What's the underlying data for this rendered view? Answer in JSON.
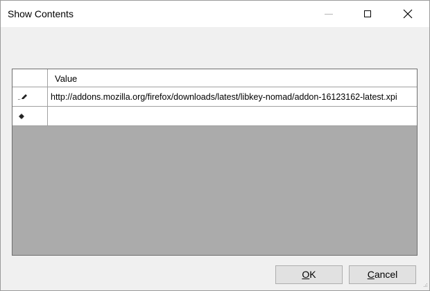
{
  "window": {
    "title": "Show Contents",
    "controls": {
      "minimize_icon": "minimize-icon",
      "maximize_icon": "maximize-icon",
      "close_icon": "close-icon"
    }
  },
  "grid": {
    "columns": [
      "Value"
    ],
    "rows": [
      {
        "state_icon": "pencil-icon",
        "value": "http://addons.mozilla.org/firefox/downloads/latest/libkey-nomad/addon-16123162-latest.xpi"
      },
      {
        "state_icon": "new-row-asterisk-icon",
        "value": ""
      }
    ]
  },
  "buttons": {
    "ok": {
      "mnemonic": "O",
      "rest": "K"
    },
    "cancel": {
      "mnemonic": "C",
      "rest": "ancel"
    }
  },
  "colors": {
    "window_bg": "#f0f0f0",
    "grid_empty_bg": "#ababab",
    "button_bg": "#e1e1e1"
  }
}
